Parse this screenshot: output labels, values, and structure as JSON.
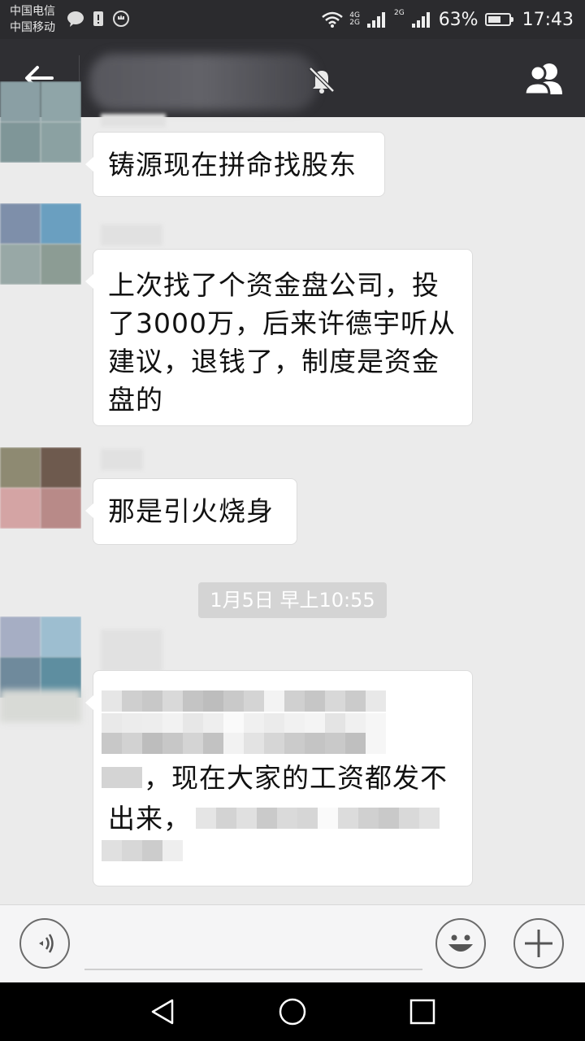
{
  "status_bar": {
    "carrier_1": "中国电信",
    "carrier_2": "中国移动",
    "net_1": "4G",
    "net_2": "2G",
    "net_3": "2G",
    "battery_text": "63%",
    "battery_level": 0.63,
    "time": "17:43"
  },
  "header": {
    "back_icon": "arrow-left-icon",
    "mute_icon": "bell-off-icon",
    "members_icon": "group-icon"
  },
  "messages": [
    {
      "text": "铸源现在拼命找股东"
    },
    {
      "text": "上次找了个资金盘公司，投了3000万，后来许德宇听从建议，退钱了，制度是资金盘的"
    },
    {
      "text": "那是引火烧身"
    }
  ],
  "timestamp": "1月5日 早上10:55",
  "last_message": {
    "visible_text_1": "，现在大家的工资都发不",
    "visible_text_2": "出来，"
  },
  "input_bar": {
    "voice_icon": "voice-icon",
    "emoji_icon": "emoji-icon",
    "plus_icon": "plus-icon"
  },
  "nav_bar": {
    "back": "nav-back-icon",
    "home": "nav-home-icon",
    "recents": "nav-recents-icon"
  },
  "colors": {
    "title_bar": "#2f2f33",
    "chat_bg": "#ebebeb",
    "bubble": "#ffffff"
  }
}
